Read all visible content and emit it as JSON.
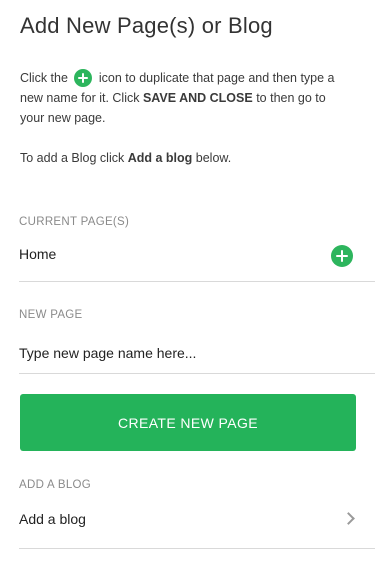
{
  "panel": {
    "title": "Add New Page(s) or Blog"
  },
  "intro": {
    "part1": "Click the",
    "part2": "icon to duplicate that page and then type a new name for it. Click",
    "bold": "SAVE AND CLOSE",
    "part3": "to then go to your new page.",
    "blog_part1": "To add a Blog click",
    "blog_bold": "Add a blog",
    "blog_part2": "below."
  },
  "current_pages": {
    "label": "CURRENT PAGE(S)",
    "items": [
      {
        "name": "Home"
      }
    ]
  },
  "new_page": {
    "label": "NEW PAGE",
    "placeholder": "Type new page name here...",
    "value": "",
    "button_label": "CREATE NEW PAGE"
  },
  "blog": {
    "label": "ADD A BLOG",
    "item_label": "Add a blog"
  },
  "colors": {
    "accent_green": "#24b35a",
    "divider": "#d9d9d9",
    "label_gray": "#8a8a8a"
  },
  "icons": {
    "inline_add": "plus-circle-icon",
    "row_add": "plus-circle-icon",
    "blog_chevron": "chevron-right-icon"
  }
}
